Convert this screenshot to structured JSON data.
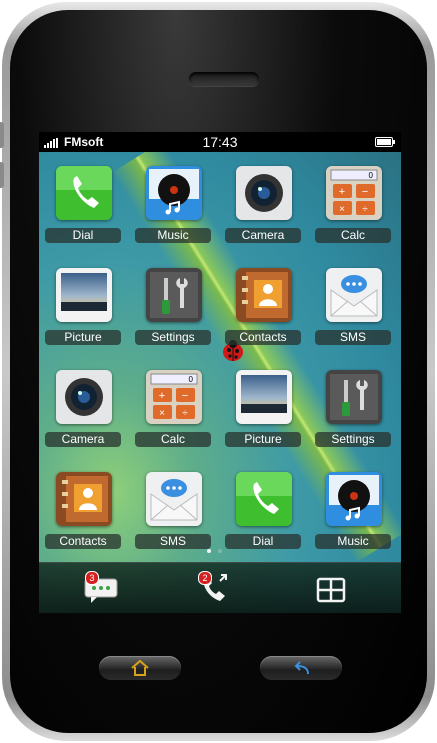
{
  "status_bar": {
    "carrier": "FMsoft",
    "time": "17:43"
  },
  "apps": [
    {
      "label": "Dial",
      "icon": "phone-icon"
    },
    {
      "label": "Music",
      "icon": "music-icon"
    },
    {
      "label": "Camera",
      "icon": "camera-icon"
    },
    {
      "label": "Calc",
      "icon": "calculator-icon"
    },
    {
      "label": "Picture",
      "icon": "picture-icon"
    },
    {
      "label": "Settings",
      "icon": "settings-icon"
    },
    {
      "label": "Contacts",
      "icon": "contacts-icon"
    },
    {
      "label": "SMS",
      "icon": "sms-icon"
    },
    {
      "label": "Camera",
      "icon": "camera-icon"
    },
    {
      "label": "Calc",
      "icon": "calculator-icon"
    },
    {
      "label": "Picture",
      "icon": "picture-icon"
    },
    {
      "label": "Settings",
      "icon": "settings-icon"
    },
    {
      "label": "Contacts",
      "icon": "contacts-icon"
    },
    {
      "label": "SMS",
      "icon": "sms-icon"
    },
    {
      "label": "Dial",
      "icon": "phone-icon"
    },
    {
      "label": "Music",
      "icon": "music-icon"
    }
  ],
  "page_indicator": {
    "pages": 2,
    "current": 1
  },
  "dock": {
    "messages_badge": "3",
    "missed_calls_badge": "2"
  },
  "colors": {
    "accent_green": "#3fbf2f",
    "badge_red": "#d42020",
    "home_icon": "#d9a21a",
    "back_icon": "#3a8fe0"
  }
}
